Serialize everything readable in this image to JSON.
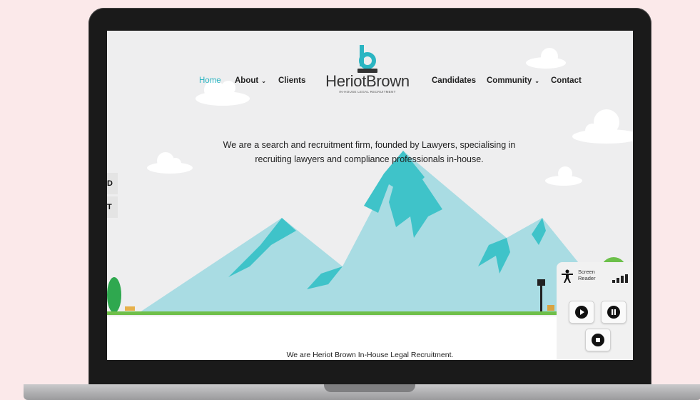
{
  "nav": {
    "home": "Home",
    "about": "About",
    "clients": "Clients",
    "candidates": "Candidates",
    "community": "Community",
    "contact": "Contact",
    "chevron": "⌄"
  },
  "logo": {
    "letter": "b",
    "wordmark": "HeriotBrown",
    "subtitle": "IN-HOUSE LEGAL RECRUITMENT"
  },
  "hero": {
    "tagline_line1": "We are a search and recruitment firm, founded by Lawyers, specialising in",
    "tagline_line2": "recruiting lawyers and compliance professionals in-house."
  },
  "intro": "We are Heriot Brown In-House Legal Recruitment.",
  "side_tabs": [
    "D",
    "T"
  ],
  "screen_reader": {
    "label_line1": "Screen",
    "label_line2": "Reader",
    "icons": [
      "accessibility-icon",
      "signal-bars-icon",
      "play-icon",
      "pause-icon",
      "stop-icon"
    ]
  },
  "colors": {
    "accent": "#2bb5c2",
    "mountain_light": "#a9dce3",
    "mountain_teal": "#3fc3c9",
    "background": "#fbe9ea"
  }
}
